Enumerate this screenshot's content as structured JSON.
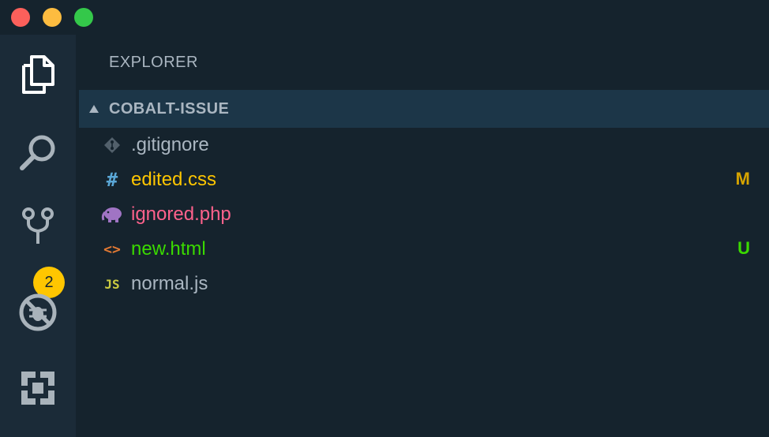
{
  "colors": {
    "titlebar_bg": "#15232d",
    "activitybar_bg": "#1b2b38",
    "sidebar_bg": "#15232d",
    "section_header_bg": "#1c3648",
    "badge_bg": "#ffc600",
    "text_muted": "#aab6c1",
    "modified": "#ffc600",
    "ignored": "#ff628c",
    "untracked": "#3ad900",
    "normal": "#aab6c1"
  },
  "activitybar": {
    "items": [
      {
        "name": "explorer",
        "icon": "files-icon"
      },
      {
        "name": "search",
        "icon": "search-icon"
      },
      {
        "name": "source-control",
        "icon": "source-control-icon"
      },
      {
        "name": "debug",
        "icon": "debug-icon"
      },
      {
        "name": "extensions",
        "icon": "extensions-icon"
      }
    ],
    "source_control_badge": "2"
  },
  "sidebar": {
    "title": "EXPLORER",
    "section": {
      "title": "COBALT-ISSUE",
      "expanded": true
    },
    "files": [
      {
        "name": ".gitignore",
        "icon": "git-icon",
        "status": "",
        "color": "#aab6c1"
      },
      {
        "name": "edited.css",
        "icon": "hash-icon",
        "status": "M",
        "color": "#ffc600"
      },
      {
        "name": "ignored.php",
        "icon": "php-elephant-icon",
        "status": "",
        "color": "#ff628c"
      },
      {
        "name": "new.html",
        "icon": "html-brackets-icon",
        "status": "U",
        "color": "#3ad900"
      },
      {
        "name": "normal.js",
        "icon": "js-icon",
        "status": "",
        "color": "#aab6c1"
      }
    ],
    "icon_glyphs": {
      "hash": "#",
      "html": "<>",
      "js": "JS"
    }
  }
}
